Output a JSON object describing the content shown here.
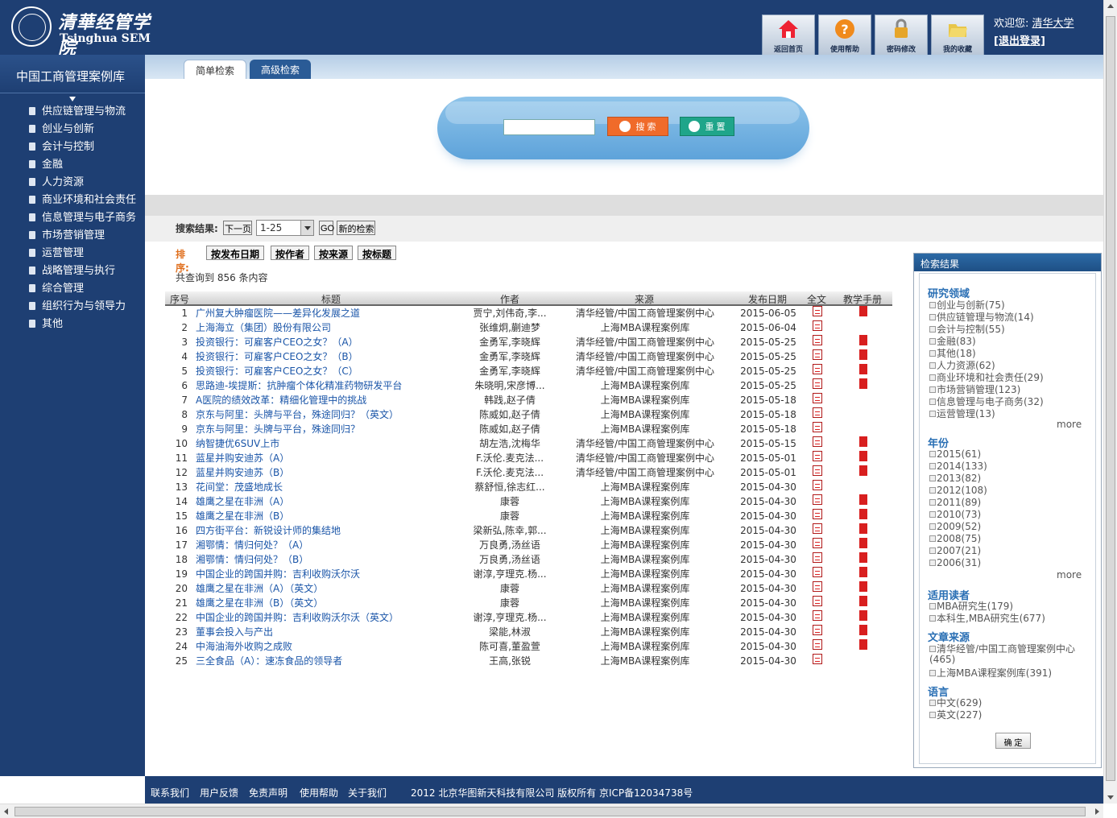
{
  "header": {
    "logo_cn": "清華经管学院",
    "logo_en": "Tsinghua SEM",
    "buttons": [
      {
        "label": "返回首页",
        "icon": "home-icon"
      },
      {
        "label": "使用帮助",
        "icon": "help-icon"
      },
      {
        "label": "密码修改",
        "icon": "lock-icon"
      },
      {
        "label": "我的收藏",
        "icon": "folder-icon"
      }
    ],
    "welcome": "欢迎您:",
    "user": "清华大学",
    "logout": "[退出登录]"
  },
  "sidebar": {
    "title": "中国工商管理案例库",
    "items": [
      "供应链管理与物流",
      "创业与创新",
      "会计与控制",
      "金融",
      "人力资源",
      "商业环境和社会责任",
      "信息管理与电子商务",
      "市场营销管理",
      "运营管理",
      "战略管理与执行",
      "综合管理",
      "组织行为与领导力",
      "其他"
    ]
  },
  "tabs": [
    "简单检索",
    "高级检索"
  ],
  "search": {
    "placeholder": "",
    "search_label": "搜 索",
    "reset_label": "重 置"
  },
  "results_bar": {
    "label": "搜索结果:",
    "next": "下一页",
    "range": "1-25",
    "go": "GO",
    "new_search": "新的检索"
  },
  "sort": {
    "label": "排序:",
    "options": [
      "按发布日期",
      "按作者",
      "按来源",
      "按标题"
    ]
  },
  "total": "共查询到 856 条内容",
  "table": {
    "headers": [
      "序号",
      "标题",
      "作者",
      "来源",
      "发布日期",
      "全文",
      "教学手册"
    ],
    "rows": [
      {
        "no": "1",
        "title": "广州复大肿瘤医院——差异化发展之道",
        "author": "贾宁,刘伟奇,李...",
        "source": "清华经管/中国工商管理案例中心",
        "date": "2015-06-05",
        "manual": true
      },
      {
        "no": "2",
        "title": "上海海立（集团）股份有限公司",
        "author": "张维炯,蒯迪梦",
        "source": "上海MBA课程案例库",
        "date": "2015-06-04",
        "manual": false
      },
      {
        "no": "3",
        "title": "投资银行：可雇客户CEO之女？（A）",
        "author": "金勇军,李晓辉",
        "source": "清华经管/中国工商管理案例中心",
        "date": "2015-05-25",
        "manual": true
      },
      {
        "no": "4",
        "title": "投资银行：可雇客户CEO之女？（B）",
        "author": "金勇军,李晓辉",
        "source": "清华经管/中国工商管理案例中心",
        "date": "2015-05-25",
        "manual": true
      },
      {
        "no": "5",
        "title": "投资银行：可雇客户CEO之女？（C）",
        "author": "金勇军,李晓辉",
        "source": "清华经管/中国工商管理案例中心",
        "date": "2015-05-25",
        "manual": true
      },
      {
        "no": "6",
        "title": "思路迪-埃提斯：抗肿瘤个体化精准药物研发平台",
        "author": "朱晓明,宋彦博...",
        "source": "上海MBA课程案例库",
        "date": "2015-05-25",
        "manual": true
      },
      {
        "no": "7",
        "title": "A医院的绩效改革：精细化管理中的挑战",
        "author": "韩践,赵子倩",
        "source": "上海MBA课程案例库",
        "date": "2015-05-18",
        "manual": false
      },
      {
        "no": "8",
        "title": "京东与阿里：头牌与平台，殊途同归？（英文）",
        "author": "陈威如,赵子倩",
        "source": "上海MBA课程案例库",
        "date": "2015-05-18",
        "manual": false
      },
      {
        "no": "9",
        "title": "京东与阿里：头牌与平台，殊途同归？",
        "author": "陈威如,赵子倩",
        "source": "上海MBA课程案例库",
        "date": "2015-05-18",
        "manual": false
      },
      {
        "no": "10",
        "title": "纳智捷优6SUV上市",
        "author": "胡左浩,沈梅华",
        "source": "清华经管/中国工商管理案例中心",
        "date": "2015-05-15",
        "manual": true
      },
      {
        "no": "11",
        "title": "蓝星并购安迪苏（A）",
        "author": "F.沃伦.麦克法...",
        "source": "清华经管/中国工商管理案例中心",
        "date": "2015-05-01",
        "manual": true
      },
      {
        "no": "12",
        "title": "蓝星并购安迪苏（B）",
        "author": "F.沃伦.麦克法...",
        "source": "清华经管/中国工商管理案例中心",
        "date": "2015-05-01",
        "manual": true
      },
      {
        "no": "13",
        "title": "花间堂：茂盛地成长",
        "author": "蔡舒恒,徐志红...",
        "source": "上海MBA课程案例库",
        "date": "2015-04-30",
        "manual": false
      },
      {
        "no": "14",
        "title": "雄鹰之星在非洲（A）",
        "author": "康蓉",
        "source": "上海MBA课程案例库",
        "date": "2015-04-30",
        "manual": true
      },
      {
        "no": "15",
        "title": "雄鹰之星在非洲（B）",
        "author": "康蓉",
        "source": "上海MBA课程案例库",
        "date": "2015-04-30",
        "manual": true
      },
      {
        "no": "16",
        "title": "四方街平台：新锐设计师的集结地",
        "author": "梁新弘,陈幸,郭...",
        "source": "上海MBA课程案例库",
        "date": "2015-04-30",
        "manual": true
      },
      {
        "no": "17",
        "title": "湘鄂情：情归何处？（A）",
        "author": "万良勇,汤丝语",
        "source": "上海MBA课程案例库",
        "date": "2015-04-30",
        "manual": true
      },
      {
        "no": "18",
        "title": "湘鄂情：情归何处？（B）",
        "author": "万良勇,汤丝语",
        "source": "上海MBA课程案例库",
        "date": "2015-04-30",
        "manual": true
      },
      {
        "no": "19",
        "title": "中国企业的跨国并购：吉利收购沃尔沃",
        "author": "谢淳,亨理克.杨...",
        "source": "上海MBA课程案例库",
        "date": "2015-04-30",
        "manual": true
      },
      {
        "no": "20",
        "title": "雄鹰之星在非洲（A）（英文）",
        "author": "康蓉",
        "source": "上海MBA课程案例库",
        "date": "2015-04-30",
        "manual": true
      },
      {
        "no": "21",
        "title": "雄鹰之星在非洲（B）（英文）",
        "author": "康蓉",
        "source": "上海MBA课程案例库",
        "date": "2015-04-30",
        "manual": true
      },
      {
        "no": "22",
        "title": "中国企业的跨国并购：吉利收购沃尔沃（英文）",
        "author": "谢淳,亨理克.杨...",
        "source": "上海MBA课程案例库",
        "date": "2015-04-30",
        "manual": true
      },
      {
        "no": "23",
        "title": "董事会投入与产出",
        "author": "梁能,林淑",
        "source": "上海MBA课程案例库",
        "date": "2015-04-30",
        "manual": true
      },
      {
        "no": "24",
        "title": "中海油海外收购之成败",
        "author": "陈可喜,董盈萱",
        "source": "上海MBA课程案例库",
        "date": "2015-04-30",
        "manual": true
      },
      {
        "no": "25",
        "title": "三全食品（A）：速冻食品的领导者",
        "author": "王高,张锐",
        "source": "上海MBA课程案例库",
        "date": "2015-04-30",
        "manual": false
      }
    ]
  },
  "facets": {
    "title": "检索结果",
    "field_h": "研究领域",
    "field": [
      "创业与创新(75)",
      "供应链管理与物流(14)",
      "会计与控制(55)",
      "金融(83)",
      "其他(18)",
      "人力资源(62)",
      "商业环境和社会责任(29)",
      "市场营销管理(123)",
      "信息管理与电子商务(32)",
      "运营管理(13)"
    ],
    "year_h": "年份",
    "year": [
      "2015(61)",
      "2014(133)",
      "2013(82)",
      "2012(108)",
      "2011(89)",
      "2010(73)",
      "2009(52)",
      "2008(75)",
      "2007(21)",
      "2006(31)"
    ],
    "reader_h": "适用读者",
    "reader": [
      "MBA研究生(179)",
      "本科生,MBA研究生(677)"
    ],
    "source_h": "文章来源",
    "source_1a": "清华经管/中国工商管理案例中心",
    "source_1b": "(465)",
    "source_2": "上海MBA课程案例库(391)",
    "lang_h": "语言",
    "lang": [
      "中文(629)",
      "英文(227)"
    ],
    "more": "more",
    "ok": "确 定"
  },
  "footer": {
    "links": [
      "联系我们",
      "用户反馈",
      "免责声明",
      "使用帮助",
      "关于我们"
    ],
    "copyright": "2012 北京华图新天科技有限公司 版权所有 京ICP备12034738号"
  },
  "colors": {
    "navy": "#1e3f73",
    "link": "#1a55a8",
    "accent": "#e0701f",
    "facet": "#2a6fb4"
  }
}
